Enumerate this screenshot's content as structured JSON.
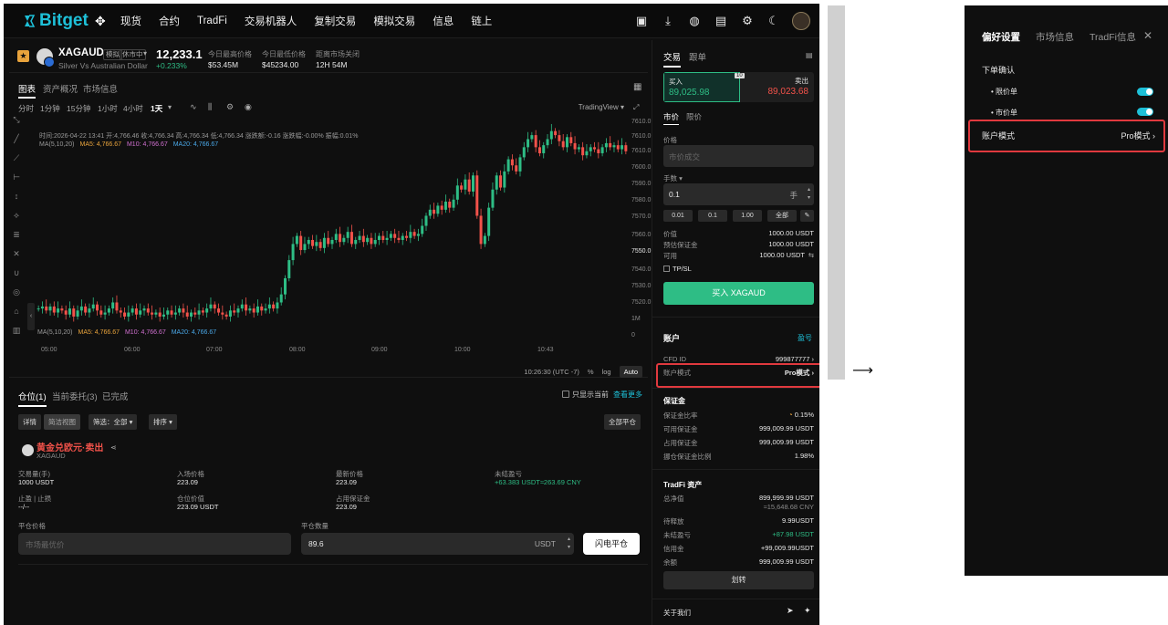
{
  "nav": {
    "brand": "Bitget",
    "menu": [
      "现货",
      "合约",
      "TradFi",
      "交易机器人",
      "复制交易",
      "模拟交易",
      "信息",
      "链上"
    ]
  },
  "ticker": {
    "symbol": "XAGAUD",
    "tag1": "模拟",
    "tag2": "休市中",
    "subtitle": "Silver Vs Australian Dollar",
    "last_price": "12,233.1",
    "change": "+0.233%",
    "stats": [
      {
        "label": "今日最高价格",
        "value": "$53.45M"
      },
      {
        "label": "今日最低价格",
        "value": "$45234.00"
      },
      {
        "label": "距离市场关闭",
        "value": "12H 54M"
      }
    ]
  },
  "chart_tabs": [
    "图表",
    "资产概况",
    "市场信息"
  ],
  "timeframes": [
    "分时",
    "1分钟",
    "15分钟",
    "1小时",
    "4小时",
    "1天"
  ],
  "tv_label": "TradingView",
  "ohlc_line": "时间:2026-04-22 13:41  开:4,766.46  收:4,766.34  高:4,766.34  低:4,766.34  涨跌额:-0.16  涨跌幅:-0.00%  振幅:0.01%",
  "ma_line": {
    "label": "MA(5,10,20)",
    "ma5": "MA5: 4,766.67",
    "ma10": "M10: 4,766.67",
    "ma20": "MA20: 4,766.67"
  },
  "ma_line2": {
    "label": "MA(5,10,20)",
    "ma5": "MA5: 4,766.67",
    "ma10": "M10: 4,766.67",
    "ma20": "MA20: 4,766.67"
  },
  "chart_bottom": {
    "time": "10:26:30 (UTC -7)",
    "pct": "%",
    "log": "log",
    "auto": "Auto"
  },
  "colors": {
    "up": "#2ebd85",
    "down": "#f2524a",
    "accent": "#1ec0d8",
    "highlight": "#e0393e"
  },
  "chart_data": {
    "type": "candlestick",
    "y_ticks": [
      "7610.0",
      "7610.0",
      "7610.0",
      "7600.0",
      "7590.0",
      "7580.0",
      "7570.0",
      "7560.0",
      "7550.0",
      "7540.0",
      "7530.0",
      "7520.0",
      "1M",
      "0"
    ],
    "x_ticks": [
      "05:00",
      "06:00",
      "07:00",
      "08:00",
      "09:00",
      "10:00",
      "10:43"
    ],
    "ylim": [
      7515,
      7620
    ],
    "series": [
      {
        "values": [
          7524,
          7525,
          7523,
          7525,
          7522,
          7524,
          7523,
          7521,
          7524,
          7520,
          7523,
          7525,
          7522,
          7524,
          7526,
          7523,
          7521,
          7522,
          7524,
          7527,
          7523,
          7522,
          7520,
          7522,
          7524,
          7521,
          7523,
          7524,
          7522,
          7521,
          7522,
          7520,
          7521,
          7523,
          7521,
          7522,
          7524,
          7522,
          7520,
          7522,
          7521,
          7523,
          7522,
          7524,
          7526,
          7524,
          7522,
          7521,
          7520,
          7523,
          7522,
          7524,
          7526,
          7523,
          7524,
          7522,
          7525,
          7523,
          7524,
          7526,
          7524,
          7527,
          7531,
          7539,
          7548,
          7556,
          7560,
          7553,
          7556,
          7558,
          7555,
          7557,
          7554,
          7559,
          7556,
          7558,
          7561,
          7557,
          7559,
          7562,
          7556,
          7558,
          7560,
          7557,
          7559,
          7556,
          7558,
          7560,
          7558,
          7559,
          7561,
          7559,
          7558,
          7560,
          7559,
          7562,
          7560,
          7561,
          7565,
          7570,
          7573,
          7571,
          7575,
          7573,
          7577,
          7574,
          7578,
          7585,
          7583,
          7588,
          7582,
          7590,
          7570,
          7556,
          7560,
          7574,
          7583,
          7590,
          7584,
          7592,
          7598,
          7595,
          7592,
          7599,
          7604,
          7608,
          7610,
          7604,
          7601,
          7605,
          7608,
          7612,
          7610,
          7607,
          7604,
          7609,
          7606,
          7603,
          7604,
          7600,
          7602,
          7604,
          7603,
          7601,
          7604,
          7606,
          7604,
          7605,
          7603,
          7605,
          7602
        ]
      }
    ]
  },
  "positions": {
    "tabs": [
      "仓位(1)",
      "当前委托(3)",
      "已完成"
    ],
    "only_current": "只显示当前",
    "view_more": "查看更多",
    "view_detail": "详情",
    "view_simple": "简洁视图",
    "filter": "筛选：全部",
    "sort": "排序",
    "close_all": "全部平仓",
    "name": "黄金兑欧元·卖出",
    "sub": "XAGAUD",
    "fields": [
      {
        "label": "交易量(手)",
        "value": "1000 USDT"
      },
      {
        "label": "入场价格",
        "value": "223.09"
      },
      {
        "label": "最新价格",
        "value": "223.09"
      },
      {
        "label": "未结盈亏",
        "value": "+63.383 USDT≈263.69 CNY"
      },
      {
        "label": "止盈 | 止损",
        "value": "--/--"
      },
      {
        "label": "仓位价值",
        "value": "223.09 USDT"
      },
      {
        "label": "占用保证金",
        "value": "223.09"
      }
    ],
    "close_price_label": "平仓价格",
    "close_price_placeholder": "市场最优价",
    "close_qty_label": "平仓数量",
    "close_qty_value": "89.6",
    "close_qty_unit": "USDT",
    "flash_close": "闪电平仓"
  },
  "rpanel": {
    "tabs": [
      "交易",
      "跟单"
    ],
    "buy_label": "买入",
    "buy_price": "89,025.98",
    "sell_label": "卖出",
    "sell_price": "89,023.68",
    "leverage": "10",
    "order_types": [
      "市价",
      "限价"
    ],
    "price_label": "价格",
    "price_placeholder": "市价成交",
    "qty_label": "手数",
    "qty_value": "0.1",
    "qty_unit": "手",
    "quick_qty": [
      "0.01",
      "0.1",
      "1.00",
      "全部"
    ],
    "rows1": [
      {
        "label": "价值",
        "value": "1000.00 USDT"
      },
      {
        "label": "预估保证金",
        "value": "1000.00 USDT"
      },
      {
        "label": "可用",
        "value": "1000.00 USDT"
      }
    ],
    "tpsl": "TP/SL",
    "buy_button": "买入 XAGAUD",
    "account_title": "账户",
    "account_link": "盈号",
    "cfd_id_label": "CFD ID",
    "cfd_id_value": "999877777",
    "account_mode_label": "账户模式",
    "account_mode_value": "Pro模式",
    "margin_title": "保证金",
    "margin_rows": [
      {
        "label": "保证金比率",
        "value": "0.15%"
      },
      {
        "label": "可用保证金",
        "value": "999,009.99 USDT"
      },
      {
        "label": "占用保证金",
        "value": "999,009.99 USDT"
      },
      {
        "label": "挪仓保证金比例",
        "value": "1.98%"
      }
    ],
    "tradfi_title": "TradFi 资产",
    "tradfi_rows": [
      {
        "label": "总净值",
        "value": "899,999.99 USDT"
      },
      {
        "label": "",
        "value": "≈15,648.68 CNY"
      },
      {
        "label": "待释放",
        "value": "9.99USDT"
      },
      {
        "label": "未结盈亏",
        "value": "+87.98 USDT"
      },
      {
        "label": "信用金",
        "value": "+99,009.99USDT"
      },
      {
        "label": "余额",
        "value": "999,009.99 USDT"
      }
    ],
    "transfer": "划转",
    "about": "关于我们"
  },
  "pref": {
    "tabs": [
      "偏好设置",
      "市场信息",
      "TradFi信息"
    ],
    "close": "✕",
    "order_confirm": "下单确认",
    "limit": "限价单",
    "market": "市价单",
    "account_mode_label": "账户模式",
    "account_mode_value": "Pro模式"
  },
  "arrow": "⟶"
}
